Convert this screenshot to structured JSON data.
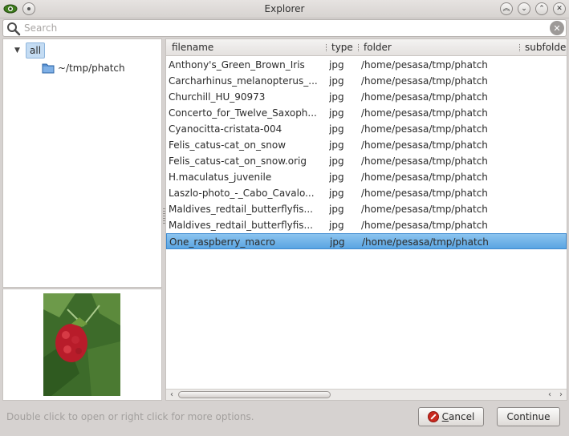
{
  "window": {
    "title": "Explorer",
    "app_icon": "eye-icon"
  },
  "search": {
    "placeholder": "Search",
    "value": ""
  },
  "tree": {
    "root": {
      "label": "all",
      "expanded": true
    },
    "children": [
      {
        "label": "~/tmp/phatch",
        "icon": "folder-icon"
      }
    ]
  },
  "list": {
    "columns": [
      "filename",
      "type",
      "folder",
      "subfolde"
    ],
    "rows": [
      {
        "filename": "Anthony's_Green_Brown_Iris",
        "type": "jpg",
        "folder": "/home/pesasa/tmp/phatch"
      },
      {
        "filename": "Carcharhinus_melanopterus_...",
        "type": "jpg",
        "folder": "/home/pesasa/tmp/phatch"
      },
      {
        "filename": "Churchill_HU_90973",
        "type": "jpg",
        "folder": "/home/pesasa/tmp/phatch"
      },
      {
        "filename": "Concerto_for_Twelve_Saxoph...",
        "type": "jpg",
        "folder": "/home/pesasa/tmp/phatch"
      },
      {
        "filename": "Cyanocitta-cristata-004",
        "type": "jpg",
        "folder": "/home/pesasa/tmp/phatch"
      },
      {
        "filename": "Felis_catus-cat_on_snow",
        "type": "jpg",
        "folder": "/home/pesasa/tmp/phatch"
      },
      {
        "filename": "Felis_catus-cat_on_snow.orig",
        "type": "jpg",
        "folder": "/home/pesasa/tmp/phatch"
      },
      {
        "filename": "H.maculatus_juvenile",
        "type": "jpg",
        "folder": "/home/pesasa/tmp/phatch"
      },
      {
        "filename": "Laszlo-photo_-_Cabo_Cavalo...",
        "type": "jpg",
        "folder": "/home/pesasa/tmp/phatch"
      },
      {
        "filename": "Maldives_redtail_butterflyfis...",
        "type": "jpg",
        "folder": "/home/pesasa/tmp/phatch"
      },
      {
        "filename": "Maldives_redtail_butterflyfis...",
        "type": "jpg",
        "folder": "/home/pesasa/tmp/phatch"
      },
      {
        "filename": "One_raspberry_macro",
        "type": "jpg",
        "folder": "/home/pesasa/tmp/phatch",
        "selected": true
      }
    ]
  },
  "footer": {
    "status": "Double click to open or right click for more options.",
    "cancel_label_first": "C",
    "cancel_label_rest": "ancel",
    "continue_label": "Continue"
  },
  "colors": {
    "selection": "#5aa5e2",
    "window_bg": "#d6d2d0",
    "cancel_icon": "#c9281e"
  }
}
